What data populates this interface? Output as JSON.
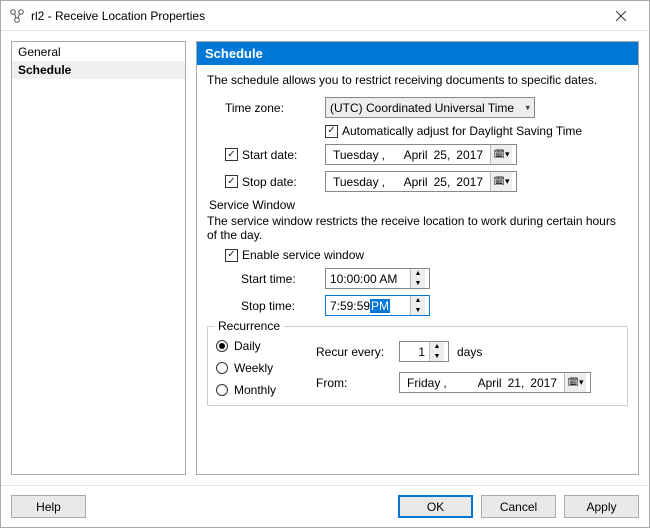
{
  "window": {
    "title": "rl2 - Receive Location Properties"
  },
  "nav": {
    "items": [
      {
        "label": "General",
        "selected": false
      },
      {
        "label": "Schedule",
        "selected": true
      }
    ]
  },
  "section": {
    "header": "Schedule",
    "description": "The schedule allows you to restrict receiving documents to specific dates."
  },
  "timezone": {
    "label": "Time zone:",
    "value": "(UTC) Coordinated Universal Time",
    "dst_label": "Automatically adjust for Daylight Saving Time",
    "dst_checked": true
  },
  "start_date": {
    "label": "Start date:",
    "checked": true,
    "weekday": "Tuesday",
    "month": "April",
    "day": "25,",
    "year": "2017"
  },
  "stop_date": {
    "label": "Stop date:",
    "checked": true,
    "weekday": "Tuesday",
    "month": "April",
    "day": "25,",
    "year": "2017"
  },
  "service_window": {
    "group_label": "Service Window",
    "description": "The service window restricts the receive location to work during certain hours of the day.",
    "enable_label": "Enable service window",
    "enable_checked": true,
    "start_time_label": "Start time:",
    "start_time_value": "10:00:00 AM",
    "stop_time_label": "Stop time:",
    "stop_time_value_prefix": "7:59:59 ",
    "stop_time_value_selected": "PM"
  },
  "recurrence": {
    "legend": "Recurrence",
    "options": {
      "daily": "Daily",
      "weekly": "Weekly",
      "monthly": "Monthly"
    },
    "selected": "daily",
    "recur_every_label": "Recur every:",
    "recur_every_value": "1",
    "recur_every_unit": "days",
    "from_label": "From:",
    "from_weekday": "Friday",
    "from_month": "April",
    "from_day": "21,",
    "from_year": "2017"
  },
  "footer": {
    "help": "Help",
    "ok": "OK",
    "cancel": "Cancel",
    "apply": "Apply"
  }
}
